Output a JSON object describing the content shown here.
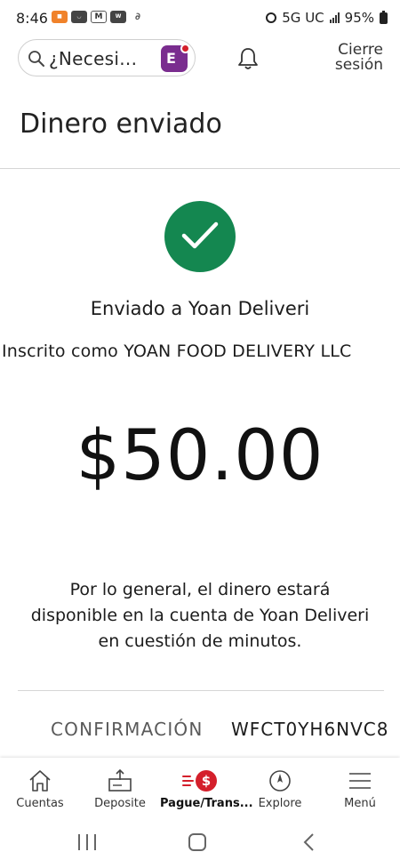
{
  "status_bar": {
    "time": "8:46",
    "network": "5G UC",
    "battery": "95%"
  },
  "header": {
    "search_placeholder": "¿Necesi...",
    "signout_line1": "Cierre",
    "signout_line2": "sesión"
  },
  "page": {
    "title": "Dinero enviado",
    "sent_to": "Enviado a Yoan Deliveri",
    "registered_as": "Inscrito como YOAN FOOD DELIVERY LLC",
    "amount": "$50.00",
    "info": "Por lo general, el dinero estará disponible en la cuenta de Yoan Deliveri en cuestión de minutos.",
    "confirmation_label": "CONFIRMACIÓN",
    "confirmation_value": "WFCT0YH6NVC8"
  },
  "tabs": [
    {
      "label": "Cuentas",
      "icon": "home-icon"
    },
    {
      "label": "Deposite",
      "icon": "deposit-icon"
    },
    {
      "label": "Pague/Trans...",
      "icon": "pay-transfer-icon",
      "active": true
    },
    {
      "label": "Explore",
      "icon": "compass-icon"
    },
    {
      "label": "Menú",
      "icon": "menu-icon"
    }
  ],
  "colors": {
    "success_green": "#148750",
    "accent_red": "#d41f2b",
    "assistant_purple": "#7a2d8f"
  }
}
